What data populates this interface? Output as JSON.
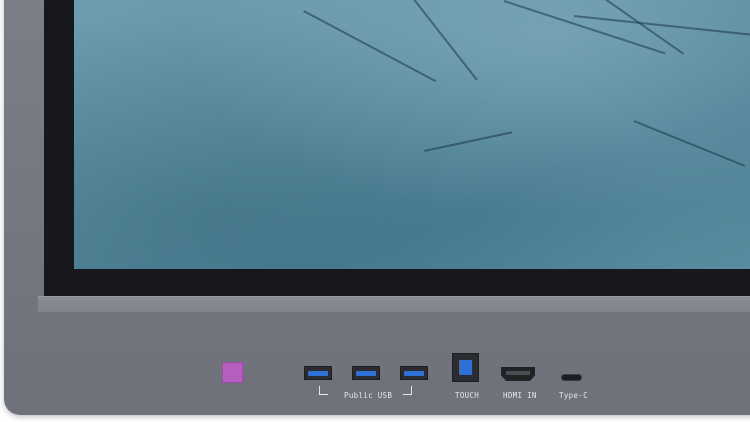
{
  "ports": {
    "public_usb_label": "Public USB",
    "touch_label": "TOUCH",
    "hdmi_label": "HDMI IN",
    "typec_label": "Type-C"
  },
  "colors": {
    "bezel": "#767982",
    "screen": "#5e8fa2",
    "port_accent": "#2f6fd8",
    "indicator": "#b65fbf"
  },
  "icons": {
    "indicator": "power-indicator-light"
  }
}
